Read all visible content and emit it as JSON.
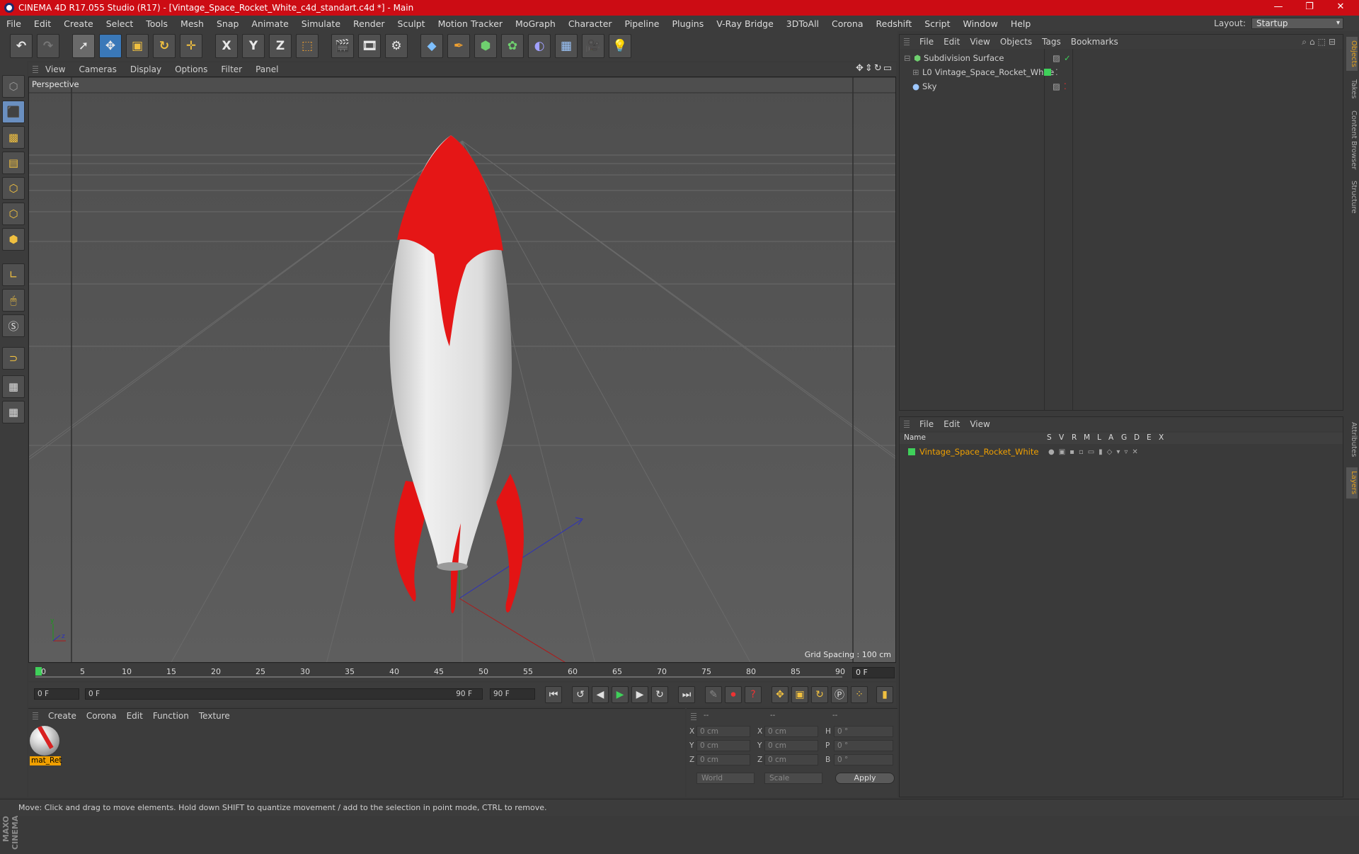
{
  "title": "CINEMA 4D R17.055 Studio (R17) - [Vintage_Space_Rocket_White_c4d_standart.c4d *] - Main",
  "menu": [
    "File",
    "Edit",
    "Create",
    "Select",
    "Tools",
    "Mesh",
    "Snap",
    "Animate",
    "Simulate",
    "Render",
    "Sculpt",
    "Motion Tracker",
    "MoGraph",
    "Character",
    "Pipeline",
    "Plugins",
    "V-Ray Bridge",
    "3DToAll",
    "Corona",
    "Redshift",
    "Script",
    "Window",
    "Help"
  ],
  "layout": {
    "label": "Layout:",
    "value": "Startup"
  },
  "toolbar": {
    "x_label": "X",
    "y_label": "Y",
    "z_label": "Z"
  },
  "viewport": {
    "menu": [
      "View",
      "Cameras",
      "Display",
      "Options",
      "Filter",
      "Panel"
    ],
    "label": "Perspective",
    "grid_spacing": "Grid Spacing : 100 cm"
  },
  "timeline": {
    "ticks": [
      "0",
      "5",
      "10",
      "15",
      "20",
      "25",
      "30",
      "35",
      "40",
      "45",
      "50",
      "55",
      "60",
      "65",
      "70",
      "75",
      "80",
      "85",
      "90"
    ],
    "current": "0 F"
  },
  "transport": {
    "start": "0 F",
    "range_start": "0 F",
    "range_end": "90 F",
    "end": "90 F"
  },
  "material_manager": {
    "menu": [
      "Create",
      "Corona",
      "Edit",
      "Function",
      "Texture"
    ],
    "material_name": "mat_Ret"
  },
  "coordinates": {
    "header": [
      "--",
      "--",
      "--"
    ],
    "rows": [
      {
        "axis": "X",
        "pos": "0 cm",
        "axis2": "X",
        "size": "0 cm",
        "rot_axis": "H",
        "rot": "0 °"
      },
      {
        "axis": "Y",
        "pos": "0 cm",
        "axis2": "Y",
        "size": "0 cm",
        "rot_axis": "P",
        "rot": "0 °"
      },
      {
        "axis": "Z",
        "pos": "0 cm",
        "axis2": "Z",
        "size": "0 cm",
        "rot_axis": "B",
        "rot": "0 °"
      }
    ],
    "mode1": "World",
    "mode2": "Scale",
    "apply": "Apply"
  },
  "object_manager": {
    "menu": [
      "File",
      "Edit",
      "View",
      "Objects",
      "Tags",
      "Bookmarks"
    ],
    "objects": [
      "Subdivision Surface",
      "Vintage_Space_Rocket_White",
      "Sky"
    ]
  },
  "layer_manager": {
    "menu": [
      "File",
      "Edit",
      "View"
    ],
    "name_header": "Name",
    "columns": [
      "S",
      "V",
      "R",
      "M",
      "L",
      "A",
      "G",
      "D",
      "E",
      "X"
    ],
    "layer_name": "Vintage_Space_Rocket_White"
  },
  "right_tabs": [
    "Objects",
    "Takes",
    "Content Browser",
    "Structure",
    "Attributes",
    "Layers"
  ],
  "status": "Move: Click and drag to move elements. Hold down SHIFT to quantize movement / add to the selection in point mode, CTRL to remove.",
  "colors": {
    "title_bar": "#cc0c14",
    "layer_text": "#f0a000",
    "rocket_red": "#e51616",
    "rocket_white": "#e6e6e6"
  }
}
